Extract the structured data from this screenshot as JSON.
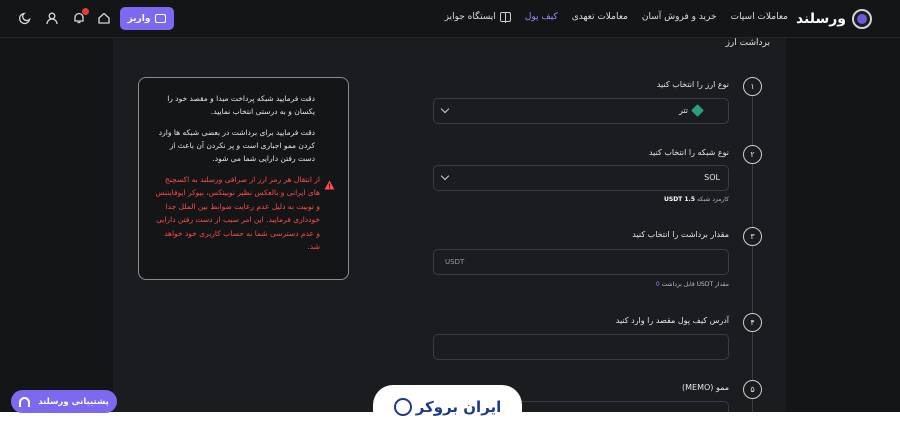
{
  "app": {
    "logo_text": "ورسلند"
  },
  "nav": {
    "items": [
      {
        "label": "معاملات اسپات",
        "active": false
      },
      {
        "label": "خرید و فروش آسان",
        "active": false
      },
      {
        "label": "معاملات تعهدی",
        "active": false
      },
      {
        "label": "کیف پول",
        "active": true
      },
      {
        "label": "ایستگاه جوایز",
        "active": false
      }
    ]
  },
  "toolbar": {
    "deposit_label": "واریز",
    "icons": [
      "home-icon",
      "bell-icon",
      "user-icon",
      "moon-icon"
    ]
  },
  "page": {
    "title": "برداشت ارز"
  },
  "steps": {
    "s1": {
      "number": "۱",
      "label": "نوع ارز را انتخاب کنید",
      "value": "تتر"
    },
    "s2": {
      "number": "۲",
      "label": "نوع شبکه را انتخاب کنید",
      "value": "SOL",
      "fee_label": "کارمزد شبکه",
      "fee_value": "1.5 USDT"
    },
    "s3": {
      "number": "۳",
      "label": "مقدار برداشت را انتخاب کنید",
      "placeholder": "USDT",
      "available_label": "مقدار USDT قابل برداشت",
      "available_value": "0"
    },
    "s4": {
      "number": "۴",
      "label": "آدرس کیف پول مقصد را وارد کنید",
      "value": ""
    },
    "s5": {
      "number": "۵",
      "label": "ممو (MEMO)"
    }
  },
  "info": {
    "para1": "دقت فرمایید شبکه پرداخت مبدا و مقصد خود را یکسان و به درستی انتخاب نمایید.",
    "para2": "دقت فرمایید برای برداشت در بعضی شبکه ها وارد کردن ممو اجباری است و پر نکردن آن باعث از دست رفتن دارایی شما می شود.",
    "warning": "از انتقال هر رمز ارز از صرافی ورسلند به اکسچنج های ایرانی و بالعکس نظیر نوبیتکس، بیوکر ایوفایننس و توبیت به دلیل عدم رعایت ضوابط بین الملل جدا خودداری فرمایید. این امر سبب از دست رفتن دارایی و عدم دسترسی شما به حساب کاربری خود خواهد شد."
  },
  "support": {
    "label": "پشتیبانی ورسلند"
  },
  "watermark": {
    "text": "ایران بروکر"
  },
  "colors": {
    "accent": "#7b69f0",
    "warning": "#ff4b4b",
    "background": "#141517"
  }
}
